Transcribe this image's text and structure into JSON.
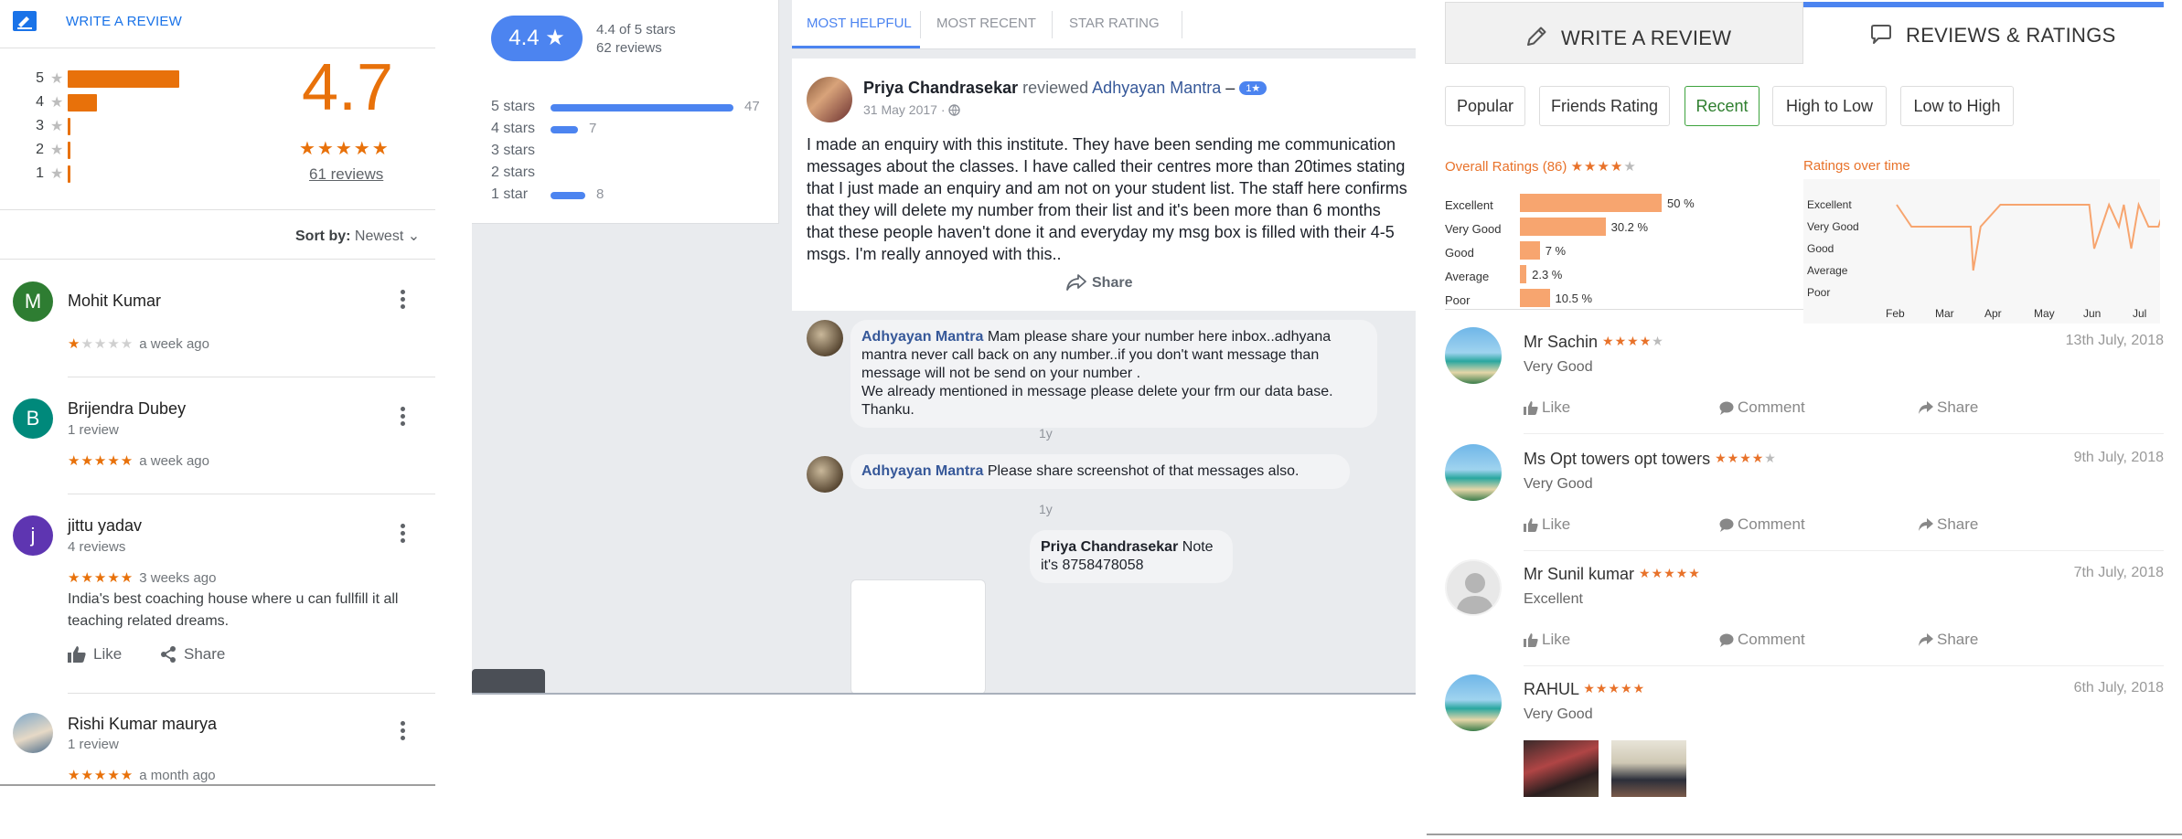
{
  "google": {
    "write_review": "WRITE A REVIEW",
    "histogram": [
      {
        "label": "5",
        "fraction": 0.8
      },
      {
        "label": "4",
        "fraction": 0.21
      },
      {
        "label": "3",
        "fraction": 0.02
      },
      {
        "label": "2",
        "fraction": 0.01
      },
      {
        "label": "1",
        "fraction": 0.02
      }
    ],
    "rating": "4.7",
    "rating_stars": "★★★★★",
    "review_count": "61 reviews",
    "sort_label": "Sort by:",
    "sort_value": "Newest",
    "reviews": [
      {
        "initial": "M",
        "color": "#2e7d32",
        "name": "Mohit Kumar",
        "sub": "",
        "stars_on": "★",
        "stars_off": "★★★★",
        "date": "a week ago",
        "text": ""
      },
      {
        "initial": "B",
        "color": "#00897b",
        "name": "Brijendra Dubey",
        "sub": "1 review",
        "stars_on": "★★★★★",
        "stars_off": "",
        "date": "a week ago",
        "text": ""
      },
      {
        "initial": "j",
        "color": "#5e35b1",
        "name": "jittu yadav",
        "sub": "4 reviews",
        "stars_on": "★★★★★",
        "stars_off": "",
        "date": "3 weeks ago",
        "text": "India's best coaching house where u can fullfill it all teaching related dreams."
      },
      {
        "initial": "",
        "color": "#90a4ae",
        "name": "Rishi Kumar maurya",
        "sub": "1 review",
        "stars_on": "★★★★★",
        "stars_off": "",
        "date": "a month ago",
        "text": ""
      }
    ],
    "like_label": "Like",
    "share_label": "Share"
  },
  "facebook": {
    "rating_badge": "4.4 ★",
    "rating_of": "4.4 of 5 stars",
    "rating_count": "62 reviews",
    "star_rows": [
      {
        "label": "5 stars",
        "count": "47",
        "fraction": 1.0
      },
      {
        "label": "4 stars",
        "count": "7",
        "fraction": 0.15
      },
      {
        "label": "3 stars",
        "count": "",
        "fraction": 0
      },
      {
        "label": "2 stars",
        "count": "",
        "fraction": 0
      },
      {
        "label": "1 star",
        "count": "8",
        "fraction": 0.19
      }
    ],
    "tabs": [
      "MOST HELPFUL",
      "MOST RECENT",
      "STAR RATING"
    ],
    "post": {
      "author": "Priya Chandrasekar",
      "verb": "reviewed",
      "page": "Adhyayan Mantra",
      "dash": "–",
      "pill": "1★",
      "date": "31 May 2017 ·",
      "text": "I made an enquiry with this institute. They have been sending me communication messages about the classes. I have called their centres more than 20times stating that I just made an enquiry and am not on your student list. The staff here confirms that they will delete my number from their list and it's been more than 6 months that these people haven't done it and everyday my msg box is filled with their 4-5 msgs. I'm really annoyed with this..",
      "share": "Share"
    },
    "comments": [
      {
        "author": "Adhyayan Mantra",
        "text": "Mam please share your number here inbox..adhyana mantra never call back on any number..if you don't want message than message will not be send on your number .\nWe already mentioned in message please delete your frm our data base.\nThanku.",
        "time": "1y"
      },
      {
        "author": "Adhyayan Mantra",
        "text": "Please share screenshot of that messages also.",
        "time": "1y"
      },
      {
        "author": "Priya Chandrasekar",
        "text": "Note it's 8758478058",
        "time": ""
      }
    ]
  },
  "site": {
    "tab_write": "WRITE A REVIEW",
    "tab_reviews": "REVIEWS & RATINGS",
    "filters": [
      "Popular",
      "Friends Rating",
      "Recent",
      "High to Low",
      "Low to High"
    ],
    "active_filter": "Recent",
    "overall_title": "Overall Ratings (86)",
    "overall_stars_on": "★★★★",
    "overall_stars_off": "★",
    "overall_rows": [
      {
        "label": "Excellent",
        "pct": "50 %",
        "value": 50
      },
      {
        "label": "Very Good",
        "pct": "30.2 %",
        "value": 30.2
      },
      {
        "label": "Good",
        "pct": "7 %",
        "value": 7
      },
      {
        "label": "Average",
        "pct": "2.3 %",
        "value": 2.3
      },
      {
        "label": "Poor",
        "pct": "10.5 %",
        "value": 10.5
      }
    ],
    "time_title": "Ratings over time",
    "chart_data": {
      "type": "line",
      "title": "Ratings over time",
      "y_categories": [
        "Excellent",
        "Very Good",
        "Good",
        "Average",
        "Poor"
      ],
      "x_ticks": [
        "Feb",
        "Mar",
        "Apr",
        "May",
        "Jun",
        "Jul"
      ],
      "series": [
        {
          "values": [
            {
              "x": 0.0,
              "y": "Excellent"
            },
            {
              "x": 0.3,
              "y": "Very Good"
            },
            {
              "x": 1.3,
              "y": "Very Good"
            },
            {
              "x": 1.5,
              "y": "Very Good"
            },
            {
              "x": 1.55,
              "y": "Average"
            },
            {
              "x": 1.7,
              "y": "Very Good"
            },
            {
              "x": 2.1,
              "y": "Excellent"
            },
            {
              "x": 3.5,
              "y": "Excellent"
            },
            {
              "x": 3.9,
              "y": "Excellent"
            },
            {
              "x": 4.0,
              "y": "Good"
            },
            {
              "x": 4.3,
              "y": "Excellent"
            },
            {
              "x": 4.5,
              "y": "Very Good"
            },
            {
              "x": 4.6,
              "y": "Excellent"
            },
            {
              "x": 4.75,
              "y": "Good"
            },
            {
              "x": 4.9,
              "y": "Excellent"
            },
            {
              "x": 5.1,
              "y": "Very Good"
            },
            {
              "x": 5.3,
              "y": "Very Good"
            },
            {
              "x": 5.45,
              "y": "Excellent"
            },
            {
              "x": 5.6,
              "y": "Very Good"
            },
            {
              "x": 5.9,
              "y": "Excellent"
            }
          ]
        }
      ]
    },
    "reviews": [
      {
        "name": "Mr Sachin",
        "stars_on": "★★★★",
        "stars_off": "★",
        "date": "13th July, 2018",
        "text": "Very Good",
        "avatar": "beach"
      },
      {
        "name": "Ms Opt towers opt towers",
        "stars_on": "★★★★",
        "stars_off": "★",
        "date": "9th July, 2018",
        "text": "Very Good",
        "avatar": "beach"
      },
      {
        "name": "Mr Sunil kumar",
        "stars_on": "★★★★★",
        "stars_off": "",
        "date": "7th July, 2018",
        "text": "Excellent",
        "avatar": "person"
      },
      {
        "name": "RAHUL",
        "stars_on": "★★★★★",
        "stars_off": "",
        "date": "6th July, 2018",
        "text": "Very Good",
        "avatar": "beach"
      }
    ],
    "like": "Like",
    "comment": "Comment",
    "share": "Share"
  }
}
